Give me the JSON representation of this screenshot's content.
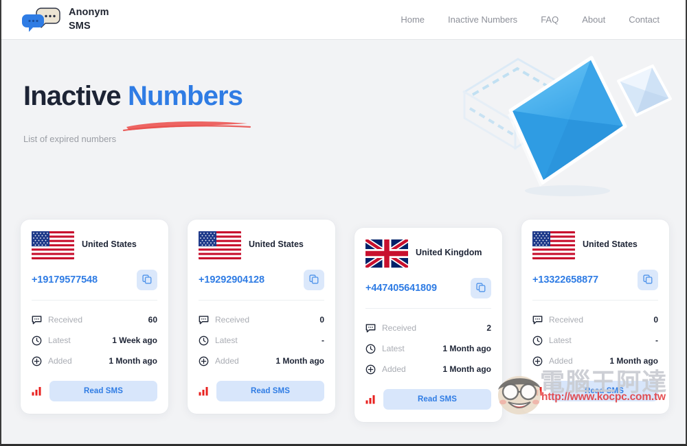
{
  "brand": {
    "line1": "Anonym",
    "line2": "SMS",
    "logo_icon": "speech-bubbles-icon"
  },
  "nav": {
    "items": [
      {
        "label": "Home"
      },
      {
        "label": "Inactive Numbers"
      },
      {
        "label": "FAQ"
      },
      {
        "label": "About"
      },
      {
        "label": "Contact"
      }
    ]
  },
  "hero": {
    "title_primary": "Inactive",
    "title_accent": "Numbers",
    "subtitle": "List of expired numbers",
    "art_icon": "envelopes-illustration",
    "underline_color": "#ef4a4a"
  },
  "colors": {
    "accent_blue": "#2f7ce4",
    "title_dark": "#1d2435",
    "muted_gray": "#a9acb3",
    "button_bg": "#d8e6fb",
    "page_bg": "#f2f3f5",
    "signal_red": "#e8211f"
  },
  "stat_labels": {
    "received": "Received",
    "latest": "Latest",
    "added": "Added"
  },
  "card_actions": {
    "copy_icon": "copy-icon",
    "signal_icon": "signal-bars-icon",
    "read_sms_label": "Read SMS"
  },
  "cards": [
    {
      "country": "United States",
      "flag": "us-flag-icon",
      "number": "+19179577548",
      "received": "60",
      "latest": "1 Week ago",
      "added": "1 Month ago",
      "read_sms_label": "Read SMS"
    },
    {
      "country": "United States",
      "flag": "us-flag-icon",
      "number": "+19292904128",
      "received": "0",
      "latest": "-",
      "added": "1 Month ago",
      "read_sms_label": "Read SMS"
    },
    {
      "country": "United Kingdom",
      "flag": "uk-flag-icon",
      "number": "+447405641809",
      "received": "2",
      "latest": "1 Month ago",
      "added": "1 Month ago",
      "read_sms_label": "Read SMS"
    },
    {
      "country": "United States",
      "flag": "us-flag-icon",
      "number": "+13322658877",
      "received": "0",
      "latest": "-",
      "added": "1 Month ago",
      "read_sms_label": "Read SMS"
    }
  ],
  "watermark": {
    "text": "電腦王阿達",
    "url": "http://www.kocpc.com.tw"
  }
}
